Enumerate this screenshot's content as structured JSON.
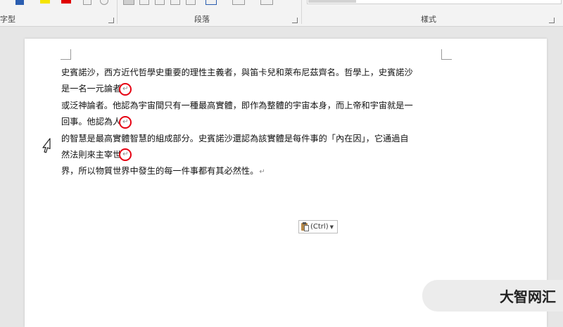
{
  "ribbon": {
    "groups": {
      "font": "字型",
      "paragraph": "段落",
      "styles": "樣式"
    },
    "colors": {
      "highlight": "#f5e400",
      "font_color": "#e00000",
      "underline_accent": "#2a5db0"
    }
  },
  "document": {
    "lines": [
      "史賓諾沙，西方近代哲學史重要的理性主義者，與笛卡兒和萊布尼茲齊名。哲學上，史賓諾沙",
      "是一名一元論者",
      "或泛神論者。他認為宇宙間只有一種最高實體，即作為整體的宇宙本身，而上帝和宇宙就是一",
      "回事。他認為人",
      "的智慧是最高實體智慧的組成部分。史賓諾沙還認為該實體是每件事的「內在因」，它通過自",
      "然法則來主宰世",
      "界，所以物質世界中發生的每一件事都有其必然性。"
    ],
    "paragraph_mark": "↵"
  },
  "paste_options": {
    "label": "(Ctrl)",
    "icon": "clipboard-icon"
  },
  "watermark": {
    "text": "大智网汇"
  }
}
